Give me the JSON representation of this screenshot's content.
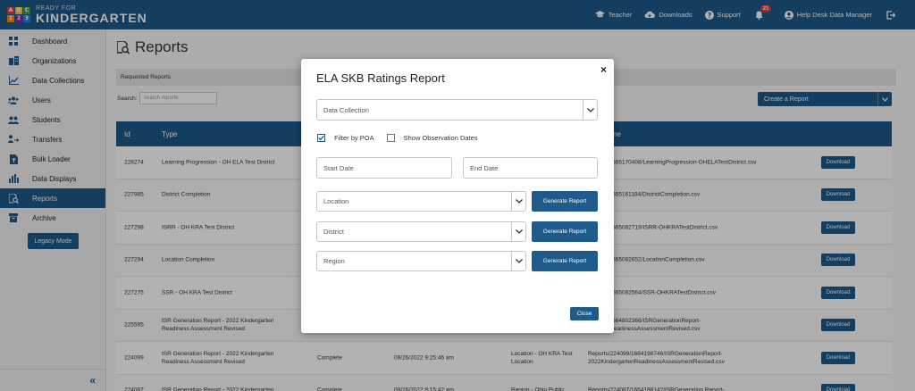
{
  "brand": {
    "small": "READY FOR",
    "big": "KINDERGARTEN",
    "blocks": [
      "A",
      "B",
      "C",
      "1",
      "2",
      "3"
    ]
  },
  "topnav": {
    "teacher": "Teacher",
    "downloads": "Downloads",
    "support": "Support",
    "notifications": "21",
    "user": "Help Desk Data Manager"
  },
  "sidebar": {
    "items": [
      {
        "label": "Dashboard",
        "icon": "dashboard-icon"
      },
      {
        "label": "Organizations",
        "icon": "organizations-icon"
      },
      {
        "label": "Data Collections",
        "icon": "data-collections-icon"
      },
      {
        "label": "Users",
        "icon": "users-icon"
      },
      {
        "label": "Students",
        "icon": "students-icon"
      },
      {
        "label": "Transfers",
        "icon": "transfers-icon"
      },
      {
        "label": "Bulk Loader",
        "icon": "bulk-loader-icon"
      },
      {
        "label": "Data Displays",
        "icon": "data-displays-icon"
      },
      {
        "label": "Reports",
        "icon": "reports-icon",
        "active": true
      },
      {
        "label": "Archive",
        "icon": "archive-icon"
      }
    ],
    "legacy": "Legacy Mode",
    "collapse": "«"
  },
  "main": {
    "title": "Reports",
    "requested": "Requested Reports",
    "search_label": "Search:",
    "search_placeholder": "search reports",
    "create": "Create a Report",
    "headers": {
      "id": "Id",
      "type": "Type",
      "name": "ne"
    },
    "rows": [
      {
        "id": "228274",
        "type": "Learning Progression - OH ELA Test District",
        "status": "",
        "date": "",
        "loc": "",
        "path": "228274/1665170408/LearningProgression-OHELATestDistrict.csv",
        "dl": "Download"
      },
      {
        "id": "227985",
        "type": "District Completion",
        "status": "",
        "date": "",
        "loc": "",
        "path": "227985/1665161184/DistrictCompletion.csv",
        "dl": "Download"
      },
      {
        "id": "227298",
        "type": "ISRR - OH KRA Test District",
        "status": "",
        "date": "",
        "loc": "",
        "path": "227298/1665082719/ISRR-OHKRATestDistrict.csv",
        "dl": "Download"
      },
      {
        "id": "227294",
        "type": "Location Completion",
        "status": "",
        "date": "",
        "loc": "",
        "path": "227294/1665082652/LocationCompletion.csv",
        "dl": "Download"
      },
      {
        "id": "227275",
        "type": "SSR - OH KRA Test District",
        "status": "",
        "date": "",
        "loc": "",
        "path": "227275/1665082564/SSR-OHKRATestDistrict.csv",
        "dl": "Download"
      },
      {
        "id": "225595",
        "type": "ISR Generation Report - 2022 Kindergarten Readiness Assessment Revised",
        "status": "",
        "date": "",
        "loc": "",
        "path": "225595/1664802366/ISRGenerationReport-ergartenReadinessAssessmentRevised.csv",
        "dl": "Download"
      },
      {
        "id": "224099",
        "type": "ISR Generation Report - 2022 Kindergarten Readiness Assessment Revised",
        "status": "Complete",
        "date": "09/26/2022 9:25:46 am",
        "loc": "Location - OH KRA Test Location",
        "path": "Reports/224099/1664198746/ISRGenerationReport-2022KindergartenReadinessAssessmentRevised.csv",
        "dl": "Download"
      },
      {
        "id": "224087",
        "type": "ISR Generation Report - 2022 Kindergarten",
        "status": "Complete",
        "date": "09/26/2022 9:15:42 am",
        "loc": "Region - Ohio Public",
        "path": "Reports/224087/1664198142/ISRGeneration Report-",
        "dl": "Download"
      }
    ]
  },
  "modal": {
    "title": "ELA SKB Ratings Report",
    "close_x": "×",
    "data_collection": "Data Collection",
    "filter_poa": "Filter by POA",
    "show_obs": "Show Observation Dates",
    "start_date": "Start Date",
    "end_date": "End Date",
    "location": "Location",
    "district": "District",
    "region": "Region",
    "generate": "Generate Report",
    "close": "Close"
  }
}
